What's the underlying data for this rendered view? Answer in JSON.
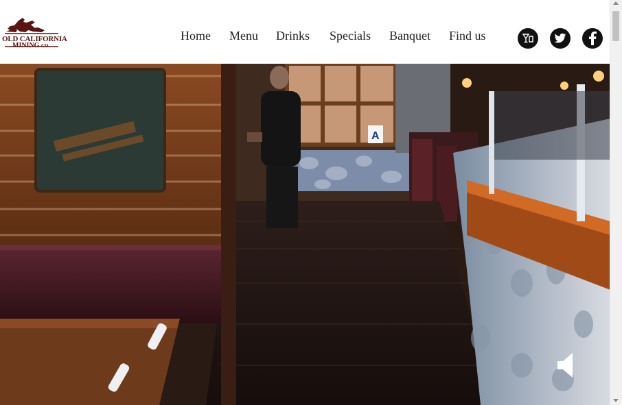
{
  "brand": {
    "line1": "OLD CALIFORNIA",
    "line2": "MINING",
    "suffix": "CO."
  },
  "nav": [
    {
      "label": "Home"
    },
    {
      "label": "Menu"
    },
    {
      "label": "Drinks"
    },
    {
      "label": "Specials"
    },
    {
      "label": "Banquet"
    },
    {
      "label": "Find us"
    }
  ],
  "social": [
    {
      "icon": "cocktail-icon"
    },
    {
      "icon": "twitter-icon"
    },
    {
      "icon": "facebook-icon"
    }
  ],
  "hero": {
    "table_sign": "A",
    "video_control": "sound-toggle"
  },
  "colors": {
    "brand": "#5a1414",
    "nav_text": "#222222",
    "social_bg": "#111111"
  }
}
